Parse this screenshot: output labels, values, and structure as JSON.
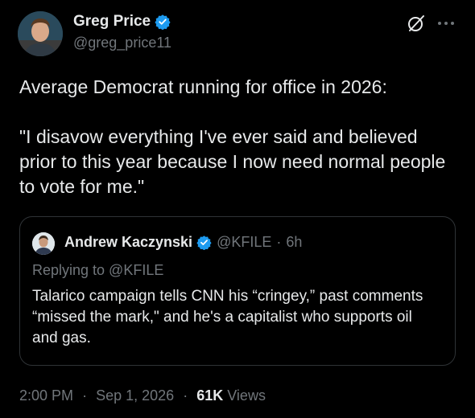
{
  "author": {
    "display_name": "Greg Price",
    "handle": "@greg_price11",
    "verified": true
  },
  "post": {
    "line1": "Average Democrat running for office in 2026:",
    "line2": "\"I disavow everything I've ever said and believed prior to this year because I now need normal people to vote for me.\""
  },
  "quoted_post": {
    "display_name": "Andrew Kaczynski",
    "handle": "@KFILE",
    "separator": "·",
    "time_ago": "6h",
    "replying_to": "Replying to @KFILE",
    "text": "Talarico campaign tells CNN his “cringey,” past comments “missed the mark,\" and he's a capitalist who supports oil and gas."
  },
  "meta": {
    "time": "2:00 PM",
    "date": "Sep 1, 2026",
    "separator": "·",
    "views_count": "61K",
    "views_label": "Views"
  },
  "icons": {
    "verified": "verified-badge-icon",
    "grok": "grok-icon",
    "more": "more-options-icon"
  },
  "colors": {
    "background": "#000000",
    "text_primary": "#e7e9ea",
    "text_secondary": "#71767b",
    "verified_blue": "#1d9bf0",
    "border": "#2f3336"
  }
}
